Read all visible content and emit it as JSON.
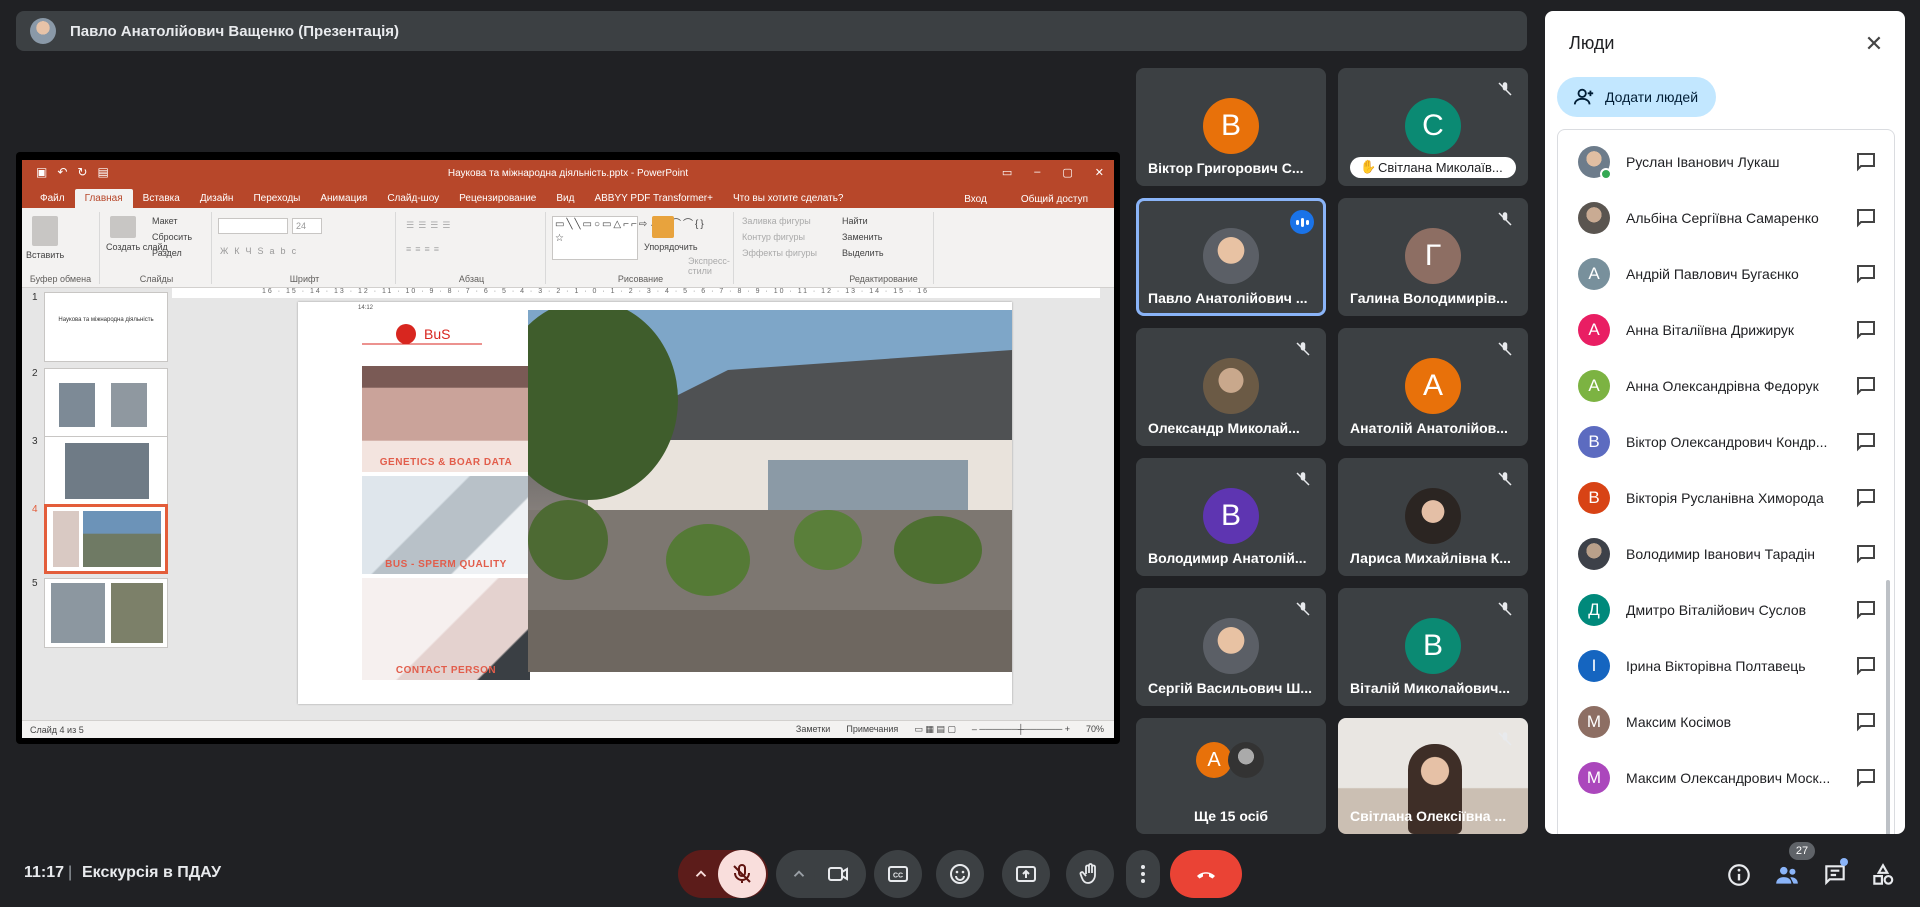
{
  "presenter_bar": {
    "name": "Павло Анатолійович Ващенко (Презентація)"
  },
  "powerpoint": {
    "title": "Наукова та міжнародна діяльність.pptx - PowerPoint",
    "tabs": [
      "Файл",
      "Главная",
      "Вставка",
      "Дизайн",
      "Переходы",
      "Анимация",
      "Слайд-шоу",
      "Рецензирование",
      "Вид",
      "ABBYY PDF Transformer+",
      "Что вы хотите сделать?"
    ],
    "tabs_right": [
      "Вход",
      "Общий доступ"
    ],
    "ribbon": {
      "paste": "Вставить",
      "create_slide": "Создать слайд",
      "layout": "Макет",
      "reset": "Сбросить",
      "section": "Раздел",
      "font_size": "24",
      "arrange": "Упорядочить",
      "express_styles": "Экспресс-стили",
      "fill": "Заливка фигуры",
      "outline": "Контур фигуры",
      "effects": "Эффекты фигуры",
      "find": "Найти",
      "replace": "Заменить",
      "select": "Выделить",
      "groups": [
        "Буфер обмена",
        "Слайды",
        "Шрифт",
        "Абзац",
        "Рисование",
        "Редактирование"
      ]
    },
    "thumbnails": [
      {
        "num": "1",
        "text": "Наукова та міжнародна діяльність"
      },
      {
        "num": "2",
        "text": ""
      },
      {
        "num": "3",
        "text": ""
      },
      {
        "num": "4",
        "text": ""
      },
      {
        "num": "5",
        "text": ""
      }
    ],
    "ruler": "16 · 15 · 14 · 13 · 12 · 11 · 10 · 9 · 8 · 7 · 6 · 5 · 4 · 3 · 2 · 1 · 0 · 1 · 2 · 3 · 4 · 5 · 6 · 7 · 8 · 9 · 10 · 11 · 12 · 13 · 14 · 15 · 16",
    "slide": {
      "phone_time": "14:12",
      "logo": "BuS",
      "panels": [
        "GENETICS & BOAR DATA",
        "BUS - SPERM QUALITY",
        "CONTACT PERSON"
      ]
    },
    "status": {
      "slide_info": "Слайд 4 из 5",
      "notes": "Заметки",
      "comments": "Примечания",
      "zoom": "70%"
    }
  },
  "tiles": [
    {
      "name": "Віктор Григорович С...",
      "initial": "В",
      "color": "#e8710a",
      "muted": false
    },
    {
      "name": "Світлана Миколаїв...",
      "initial": "С",
      "color": "#0b8a73",
      "muted": true,
      "chip": true
    },
    {
      "name": "Павло Анатолійович ...",
      "initial": "",
      "color": "",
      "speaking": true
    },
    {
      "name": "Галина Володимирів...",
      "initial": "Г",
      "color": "#8d6e63",
      "muted": true
    },
    {
      "name": "Олександр Миколай...",
      "initial": "",
      "color": "",
      "muted": true
    },
    {
      "name": "Анатолій Анатолійов...",
      "initial": "А",
      "color": "#e8710a",
      "muted": true
    },
    {
      "name": "Володимир Анатолій...",
      "initial": "В",
      "color": "#5e35b1",
      "muted": true
    },
    {
      "name": "Лариса Михайлівна К...",
      "initial": "",
      "color": "",
      "muted": true
    },
    {
      "name": "Сергій Васильович Ш...",
      "initial": "",
      "color": "",
      "muted": true
    },
    {
      "name": "Віталій Миколайович...",
      "initial": "В",
      "color": "#0b8a73",
      "muted": true
    },
    {
      "name": "Ще 15 осіб",
      "initial": "А",
      "color": "#e8710a"
    },
    {
      "name": "Світлана Олексіївна ...",
      "initial": "",
      "color": "",
      "muted": true
    }
  ],
  "people_panel": {
    "title": "Люди",
    "add_people": "Додати людей",
    "people": [
      {
        "name": "Руслан Іванович Лукаш",
        "initial": "",
        "color": "#7b8a99"
      },
      {
        "name": "Альбіна Сергіївна Самаренко",
        "initial": "",
        "color": "#6f6a65"
      },
      {
        "name": "Андрій Павлович Бугаєнко",
        "initial": "А",
        "color": "#78909c"
      },
      {
        "name": "Анна Віталіївна Дрижирук",
        "initial": "А",
        "color": "#e91e63"
      },
      {
        "name": "Анна Олександрівна Федорук",
        "initial": "А",
        "color": "#7cb342"
      },
      {
        "name": "Віктор Олександрович Кондр...",
        "initial": "В",
        "color": "#5c6bc0"
      },
      {
        "name": "Вікторія Русланівна Химорода",
        "initial": "В",
        "color": "#d84315"
      },
      {
        "name": "Володимир Іванович Тарадін",
        "initial": "",
        "color": "#555b66"
      },
      {
        "name": "Дмитро Віталійович Суслов",
        "initial": "Д",
        "color": "#00897b"
      },
      {
        "name": "Ірина Вікторівна Полтавець",
        "initial": "І",
        "color": "#1565c0"
      },
      {
        "name": "Максим Косімов",
        "initial": "М",
        "color": "#8d6e63"
      },
      {
        "name": "Максим Олександрович Моск...",
        "initial": "М",
        "color": "#ab47bc"
      }
    ]
  },
  "bottom_bar": {
    "time": "11:17",
    "separator": "|",
    "meeting_name": "Екскурсія в ПДАУ",
    "participants_count": "27"
  },
  "colors": {
    "background": "#202124",
    "tile": "#3c4043",
    "end_call": "#ea4335",
    "mic_off_bg": "#f9dedc",
    "accent": "#8ab4f8"
  }
}
